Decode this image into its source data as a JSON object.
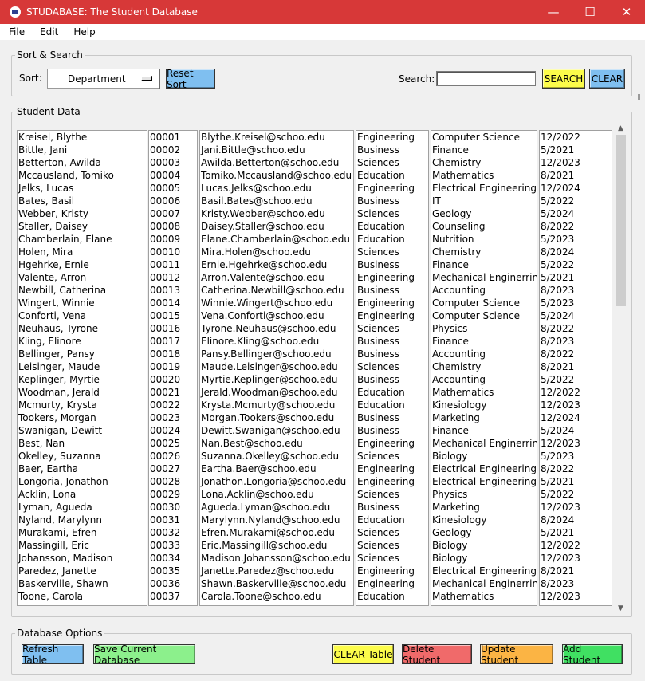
{
  "window": {
    "title": "STUDABASE: The Student Database",
    "controls": {
      "minimize": "—",
      "maximize": "☐",
      "close": "✕"
    }
  },
  "menu": {
    "items": [
      "File",
      "Edit",
      "Help"
    ]
  },
  "sort_search": {
    "group_title": "Sort & Search",
    "sort_label": "Sort:",
    "sort_value": "Department",
    "reset_sort": "Reset Sort",
    "search_label": "Search:",
    "search_value": "",
    "search_button": "SEARCH",
    "clear_button": "CLEAR"
  },
  "student_data": {
    "group_title": "Student Data",
    "names": [
      "Kreisel, Blythe",
      "Bittle, Jani",
      "Betterton, Awilda",
      "Mccausland, Tomiko",
      "Jelks, Lucas",
      "Bates, Basil",
      "Webber, Kristy",
      "Staller, Daisey",
      "Chamberlain, Elane",
      "Holen, Mira",
      "Hgehrke, Ernie",
      "Valente, Arron",
      "Newbill, Catherina",
      "Wingert, Winnie",
      "Conforti, Vena",
      "Neuhaus, Tyrone",
      "Kling, Elinore",
      "Bellinger, Pansy",
      "Leisinger, Maude",
      "Keplinger, Myrtie",
      "Woodman, Jerald",
      "Mcmurty, Krysta",
      "Tookers, Morgan",
      "Swanigan, Dewitt",
      "Best, Nan",
      "Okelley, Suzanna",
      "Baer, Eartha",
      "Longoria, Jonathon",
      "Acklin, Lona",
      "Lyman, Agueda",
      "Nyland, Marylynn",
      "Murakami, Efren",
      "Massingill, Eric",
      "Johansson, Madison",
      "Paredez, Janette",
      "Baskerville, Shawn",
      "Toone, Carola"
    ],
    "ids": [
      "00001",
      "00002",
      "00003",
      "00004",
      "00005",
      "00006",
      "00007",
      "00008",
      "00009",
      "00010",
      "00011",
      "00012",
      "00013",
      "00014",
      "00015",
      "00016",
      "00017",
      "00018",
      "00019",
      "00020",
      "00021",
      "00022",
      "00023",
      "00024",
      "00025",
      "00026",
      "00027",
      "00028",
      "00029",
      "00030",
      "00031",
      "00032",
      "00033",
      "00034",
      "00035",
      "00036",
      "00037"
    ],
    "emails": [
      "Blythe.Kreisel@schoo.edu",
      "Jani.Bittle@schoo.edu",
      "Awilda.Betterton@schoo.edu",
      "Tomiko.Mccausland@schoo.edu",
      "Lucas.Jelks@schoo.edu",
      "Basil.Bates@schoo.edu",
      "Kristy.Webber@schoo.edu",
      "Daisey.Staller@schoo.edu",
      "Elane.Chamberlain@schoo.edu",
      "Mira.Holen@schoo.edu",
      "Ernie.Hgehrke@schoo.edu",
      "Arron.Valente@schoo.edu",
      "Catherina.Newbill@schoo.edu",
      "Winnie.Wingert@schoo.edu",
      "Vena.Conforti@schoo.edu",
      "Tyrone.Neuhaus@schoo.edu",
      "Elinore.Kling@schoo.edu",
      "Pansy.Bellinger@schoo.edu",
      "Maude.Leisinger@schoo.edu",
      "Myrtie.Keplinger@schoo.edu",
      "Jerald.Woodman@schoo.edu",
      "Krysta.Mcmurty@schoo.edu",
      "Morgan.Tookers@schoo.edu",
      "Dewitt.Swanigan@schoo.edu",
      "Nan.Best@schoo.edu",
      "Suzanna.Okelley@schoo.edu",
      "Eartha.Baer@schoo.edu",
      "Jonathon.Longoria@schoo.edu",
      "Lona.Acklin@schoo.edu",
      "Agueda.Lyman@schoo.edu",
      "Marylynn.Nyland@schoo.edu",
      "Efren.Murakami@schoo.edu",
      "Eric.Massingill@schoo.edu",
      "Madison.Johansson@schoo.edu",
      "Janette.Paredez@schoo.edu",
      "Shawn.Baskerville@schoo.edu",
      "Carola.Toone@schoo.edu"
    ],
    "departments": [
      "Engineering",
      "Business",
      "Sciences",
      "Education",
      "Engineering",
      "Business",
      "Sciences",
      "Education",
      "Education",
      "Sciences",
      "Business",
      "Engineering",
      "Business",
      "Engineering",
      "Engineering",
      "Sciences",
      "Business",
      "Business",
      "Sciences",
      "Business",
      "Education",
      "Education",
      "Business",
      "Business",
      "Engineering",
      "Sciences",
      "Engineering",
      "Engineering",
      "Sciences",
      "Business",
      "Education",
      "Sciences",
      "Sciences",
      "Sciences",
      "Engineering",
      "Engineering",
      "Education"
    ],
    "majors": [
      "Computer Science",
      "Finance",
      "Chemistry",
      "Mathematics",
      "Electrical Engineering",
      "IT",
      "Geology",
      "Counseling",
      "Nutrition",
      "Chemistry",
      "Finance",
      "Mechanical Enginerring",
      "Accounting",
      "Computer Science",
      "Computer Science",
      "Physics",
      "Finance",
      "Accounting",
      "Chemistry",
      "Accounting",
      "Mathematics",
      "Kinesiology",
      "Marketing",
      "Finance",
      "Mechanical Enginerring",
      "Biology",
      "Electrical Engineering",
      "Electrical Engineering",
      "Physics",
      "Marketing",
      "Kinesiology",
      "Geology",
      "Biology",
      "Biology",
      "Electrical Engineering",
      "Mechanical Enginerring",
      "Mathematics"
    ],
    "graduation": [
      "12/2022",
      "5/2021",
      "12/2023",
      "8/2021",
      "12/2024",
      "5/2022",
      "5/2024",
      "8/2022",
      "5/2023",
      "8/2024",
      "5/2022",
      "5/2021",
      "8/2023",
      "5/2023",
      "5/2024",
      "8/2022",
      "8/2023",
      "8/2022",
      "8/2021",
      "5/2022",
      "12/2022",
      "12/2023",
      "12/2024",
      "5/2024",
      "12/2023",
      "5/2023",
      "8/2022",
      "5/2021",
      "5/2022",
      "12/2023",
      "8/2024",
      "5/2021",
      "12/2022",
      "12/2023",
      "8/2021",
      "8/2023",
      "12/2023"
    ]
  },
  "database_options": {
    "group_title": "Database Options",
    "refresh": "Refresh Table",
    "save": "Save Current Database",
    "clear_table": "CLEAR Table",
    "delete": "Delete Student",
    "update": "Update Student",
    "add": "Add Student"
  },
  "colors": {
    "titlebar": "#d73838",
    "blue_button": "#7fbff0",
    "yellow_button": "#fcfc4a",
    "green_button": "#8cf08c",
    "red_button": "#f06a6a",
    "orange_button": "#fbb444",
    "add_green": "#40e062"
  },
  "scroll": {
    "up_icon": "▲",
    "down_icon": "▼"
  }
}
